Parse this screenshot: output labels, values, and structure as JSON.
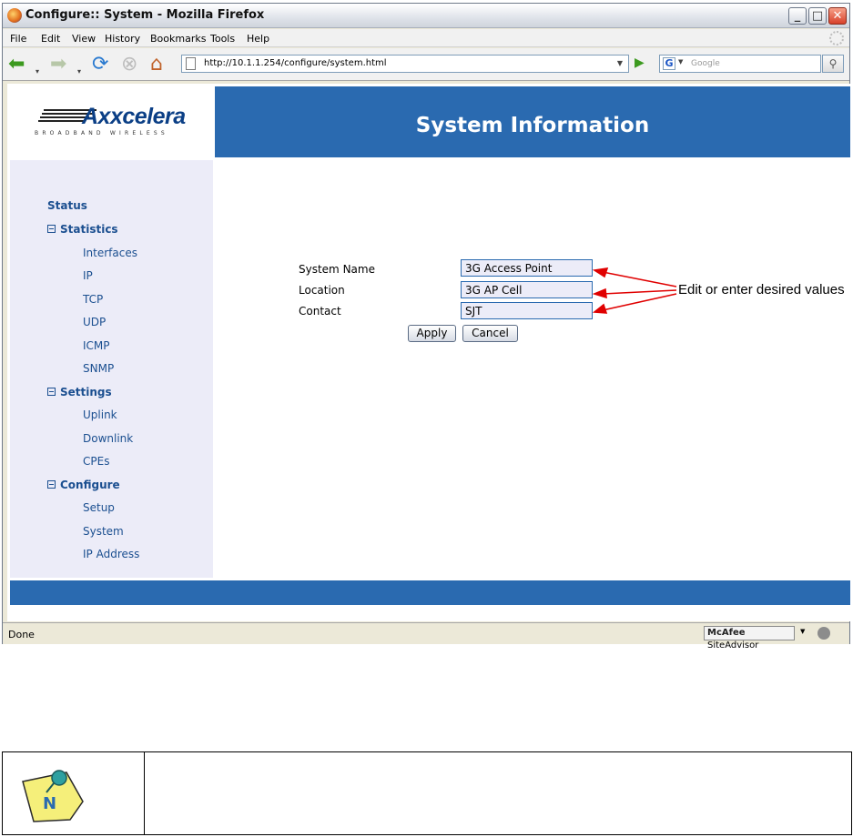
{
  "window": {
    "title": "Configure:: System - Mozilla Firefox"
  },
  "menu": [
    "File",
    "Edit",
    "View",
    "History",
    "Bookmarks",
    "Tools",
    "Help"
  ],
  "navigation": {
    "url": "http://10.1.1.254/configure/system.html",
    "search_placeholder": "Google"
  },
  "brand": {
    "name": "Axxcelera",
    "tagline": "BROADBAND WIRELESS"
  },
  "page": {
    "title": "System Information"
  },
  "sidebar": {
    "status": "Status",
    "statistics": {
      "label": "Statistics",
      "items": [
        "Interfaces",
        "IP",
        "TCP",
        "UDP",
        "ICMP",
        "SNMP"
      ]
    },
    "settings": {
      "label": "Settings",
      "items": [
        "Uplink",
        "Downlink",
        "CPEs"
      ]
    },
    "configure": {
      "label": "Configure",
      "items": [
        "Setup",
        "System",
        "IP Address"
      ]
    }
  },
  "form": {
    "fields": [
      {
        "label": "System Name",
        "value": "3G Access Point"
      },
      {
        "label": "Location",
        "value": "3G AP Cell"
      },
      {
        "label": "Contact",
        "value": "SJT"
      }
    ],
    "apply_label": "Apply",
    "cancel_label": "Cancel"
  },
  "annotation": {
    "text": "Edit or enter desired values",
    "color": "#e00000"
  },
  "statusbar": {
    "status": "Done",
    "addon_brand": "McAfee",
    "addon_name": "SiteAdvisor"
  },
  "colors": {
    "header_blue": "#2a6ab0",
    "sidebar_bg": "#ececf8",
    "link_blue": "#1b4f90"
  }
}
